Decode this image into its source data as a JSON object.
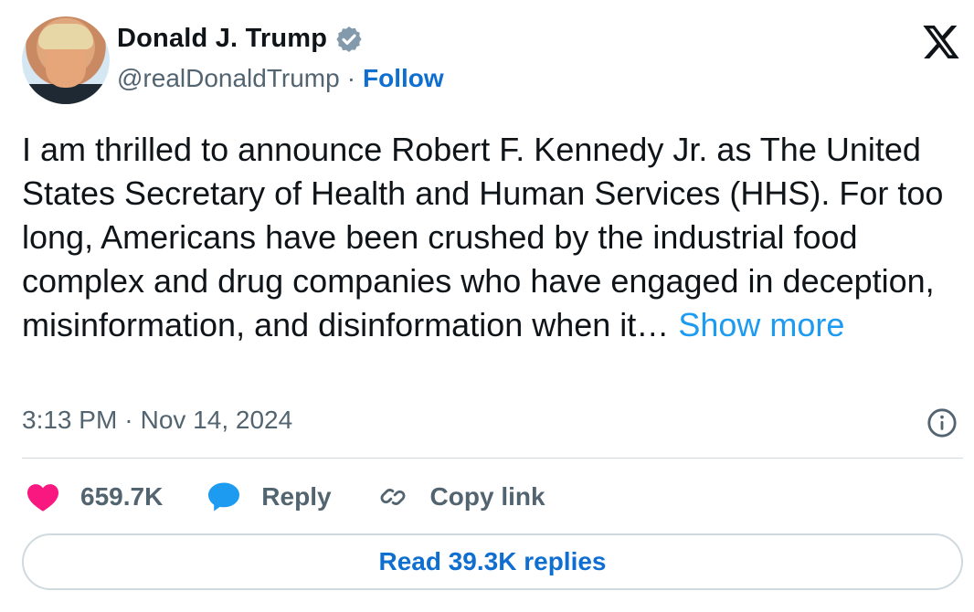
{
  "header": {
    "name": "Donald J. Trump",
    "handle": "@realDonaldTrump",
    "separator": "·",
    "follow_label": "Follow",
    "verified_color": "#829aab"
  },
  "tweet": {
    "text": "I am thrilled to announce Robert F. Kennedy Jr. as The United States Secretary of Health and Human Services (HHS). For too long, Americans have been crushed by the industrial food complex and drug companies who have engaged in deception, misinformation, and disinformation when it… ",
    "show_more_label": "Show more"
  },
  "meta": {
    "time": "3:13 PM",
    "separator": "·",
    "date": "Nov 14, 2024"
  },
  "actions": {
    "likes": "659.7K",
    "reply_label": "Reply",
    "copy_link_label": "Copy link"
  },
  "replies_button_label": "Read 39.3K replies",
  "colors": {
    "heart": "#f91880",
    "reply_bubble": "#1d9bf0",
    "link": "#1d9bf0",
    "follow": "#0f6fd1",
    "secondary_text": "#536471"
  },
  "icons": [
    "verified-badge-icon",
    "x-logo-icon",
    "info-icon",
    "heart-icon",
    "reply-bubble-icon",
    "link-icon"
  ]
}
